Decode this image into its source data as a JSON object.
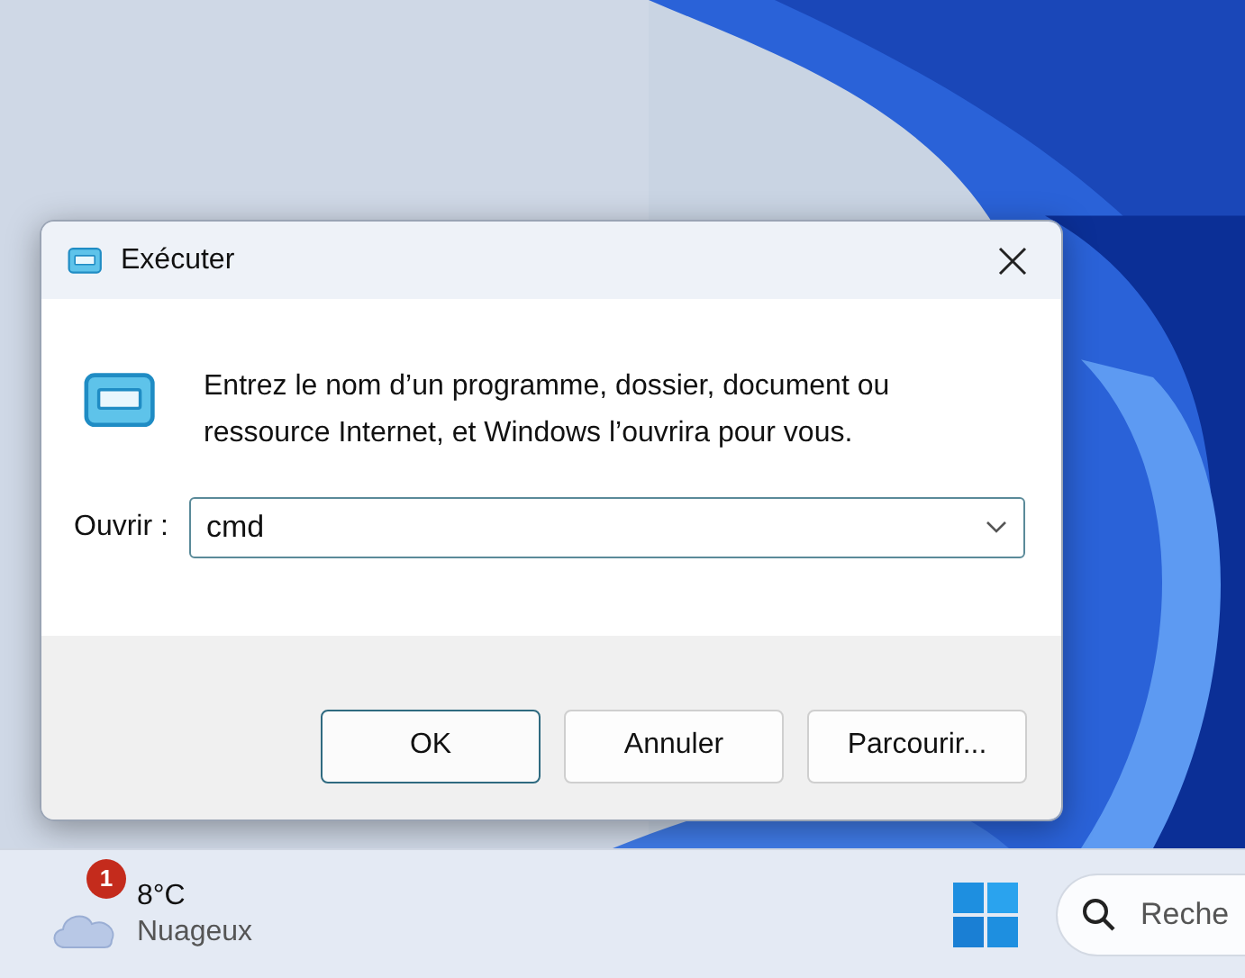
{
  "dialog": {
    "title": "Exécuter",
    "message": "Entrez le nom d’un programme, dossier, document ou ressource Internet, et Windows l’ouvrira pour vous.",
    "open_label": "Ouvrir :",
    "open_value": "cmd",
    "buttons": [
      {
        "label": "OK",
        "selected": true
      },
      {
        "label": "Annuler",
        "selected": false
      },
      {
        "label": "Parcourir...",
        "selected": false
      }
    ]
  },
  "taskbar": {
    "weather": {
      "badge": "1",
      "temperature": "8°C",
      "condition": "Nuageux"
    },
    "search": {
      "placeholder": "Reche"
    }
  }
}
